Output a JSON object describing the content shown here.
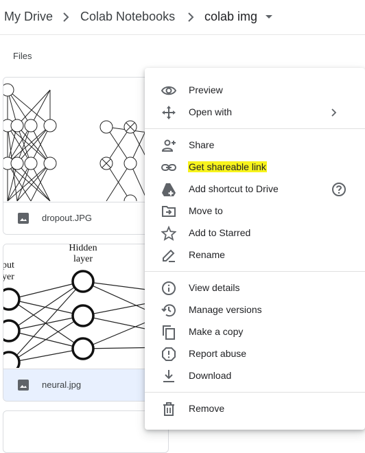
{
  "breadcrumb": {
    "items": [
      "My Drive",
      "Colab Notebooks",
      "colab img"
    ]
  },
  "files_label": "Files",
  "files": [
    {
      "name": "dropout.JPG",
      "icon": "image-icon",
      "selected": false
    },
    {
      "name": "neural.jpg",
      "icon": "image-icon",
      "selected": true
    }
  ],
  "thumb_neural": {
    "hidden_label_1": "Hidden",
    "hidden_label_2": "layer",
    "input_label_1": "put",
    "input_label_2": "yer"
  },
  "context_menu": {
    "preview": "Preview",
    "open_with": "Open with",
    "share": "Share",
    "get_link": "Get shareable link",
    "add_shortcut": "Add shortcut to Drive",
    "move_to": "Move to",
    "add_starred": "Add to Starred",
    "rename": "Rename",
    "view_details": "View details",
    "manage_versions": "Manage versions",
    "make_copy": "Make a copy",
    "report_abuse": "Report abuse",
    "download": "Download",
    "remove": "Remove"
  },
  "colors": {
    "highlight": "#f7f31d",
    "selected_row": "#e8f0fe",
    "icon": "#5f6368"
  }
}
